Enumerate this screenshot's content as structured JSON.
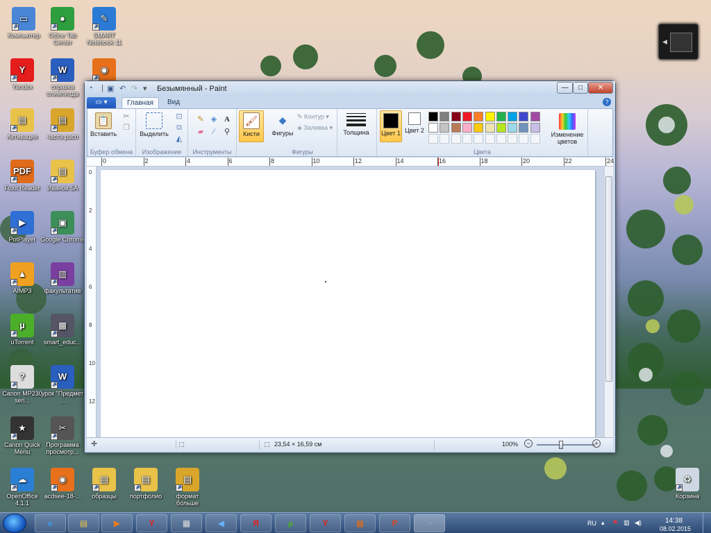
{
  "desktop": {
    "icons": [
      {
        "label": "Компьютер",
        "glyph": "▭",
        "color": "#4a86d8"
      },
      {
        "label": "Office Tab Center",
        "glyph": "●",
        "color": "#2e9e3e"
      },
      {
        "label": "SMART Notebook 11",
        "glyph": "✎",
        "color": "#2b7bd6"
      },
      {
        "label": "Yandex",
        "glyph": "Y",
        "color": "#e41d1d"
      },
      {
        "label": "справка олимпиада",
        "glyph": "W",
        "color": "#2a5ebf"
      },
      {
        "label": "ACD",
        "glyph": "◉",
        "color": "#e8701a"
      },
      {
        "label": "Активация",
        "glyph": "▤",
        "color": "#e9c24a"
      },
      {
        "label": "часта расп",
        "glyph": "▤",
        "color": "#d9a62b"
      },
      {
        "label": "Foxit Reader",
        "glyph": "PDF",
        "color": "#e06b1a"
      },
      {
        "label": "Иванов 5А",
        "glyph": "▤",
        "color": "#e9c24a"
      },
      {
        "label": "PotPlayer",
        "glyph": "▶",
        "color": "#2f6fd6"
      },
      {
        "label": "Google Chrome",
        "glyph": "▣",
        "color": "#3d8f5a"
      },
      {
        "label": "AIMP3",
        "glyph": "▲",
        "color": "#f0a020"
      },
      {
        "label": "факультатив",
        "glyph": "▥",
        "color": "#7a3fa0"
      },
      {
        "label": "uTorrent",
        "glyph": "µ",
        "color": "#4caf2a"
      },
      {
        "label": "smart_educ...",
        "glyph": "▦",
        "color": "#556"
      },
      {
        "label": "Canon MP230 seri...",
        "glyph": "?",
        "color": "#ddd"
      },
      {
        "label": "урок \"Предмет ...",
        "glyph": "W",
        "color": "#2a5ebf"
      },
      {
        "label": "Canon Quick Menu",
        "glyph": "★",
        "color": "#333"
      },
      {
        "label": "Программа просмотр...",
        "glyph": "✂",
        "color": "#555"
      },
      {
        "label": "OpenOffice 4.1.1",
        "glyph": "☁",
        "color": "#2a7fd4"
      },
      {
        "label": "acdsee-18-...",
        "glyph": "◉",
        "color": "#e8701a"
      },
      {
        "label": "образцы",
        "glyph": "▤",
        "color": "#e9c24a"
      },
      {
        "label": "портфолио",
        "glyph": "▤",
        "color": "#e9c24a"
      },
      {
        "label": "формат больше",
        "glyph": "▤",
        "color": "#d9a62b"
      },
      {
        "label": "Корзина",
        "glyph": "♻",
        "color": "#cfd8e2"
      }
    ]
  },
  "window": {
    "title": "Безымянный - Paint",
    "controls": {
      "min": "—",
      "max": "□",
      "close": "✕"
    },
    "tabs": {
      "file": "▭ ▾",
      "home": "Главная",
      "view": "Вид"
    },
    "help": "?",
    "ribbon": {
      "clipboard": {
        "paste": "Вставить",
        "label": "Буфер обмена"
      },
      "image": {
        "select": "Выделить",
        "label": "Изображение"
      },
      "tools": {
        "label": "Инструменты"
      },
      "brushes": {
        "label": "Кисти"
      },
      "shapes": {
        "shapes": "Фигуры",
        "outline": "Контур",
        "fill": "Заливка",
        "label": "Фигуры"
      },
      "thickness": {
        "label": "Толщина"
      },
      "colors": {
        "color1": "Цвет 1",
        "color2": "Цвет 2",
        "edit": "Изменение цветов",
        "label": "Цвета"
      }
    },
    "palette": [
      "#000000",
      "#7f7f7f",
      "#880015",
      "#ed1c24",
      "#ff7f27",
      "#fff200",
      "#22b14c",
      "#00a2e8",
      "#3f48cc",
      "#a349a4",
      "#ffffff",
      "#c3c3c3",
      "#b97a57",
      "#ffaec9",
      "#ffc90e",
      "#efe4b0",
      "#b5e61d",
      "#99d9ea",
      "#7092be",
      "#c8bfe7"
    ],
    "ruler_h": [
      "0",
      "2",
      "4",
      "6",
      "8",
      "10",
      "12",
      "14",
      "16",
      "18",
      "20",
      "22",
      "24"
    ],
    "ruler_v": [
      "0",
      "2",
      "4",
      "6",
      "8",
      "10",
      "12",
      "14"
    ],
    "status": {
      "size": "23,54 × 16,59 см",
      "zoom": "100%"
    }
  },
  "taskbar": {
    "lang": "RU",
    "time": "14:38",
    "date": "08.02.2015"
  }
}
